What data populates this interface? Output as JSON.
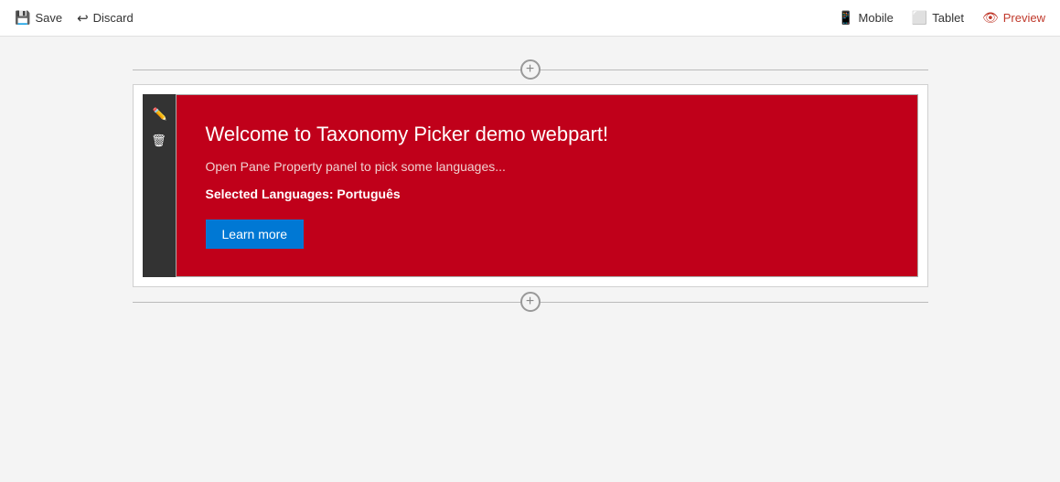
{
  "toolbar": {
    "save_label": "Save",
    "discard_label": "Discard",
    "mobile_label": "Mobile",
    "tablet_label": "Tablet",
    "preview_label": "Preview"
  },
  "webpart": {
    "title": "Welcome to Taxonomy Picker demo webpart!",
    "subtitle": "Open Pane Property panel to pick some languages...",
    "selected_text": "Selected Languages: Português",
    "learn_more_label": "Learn more"
  },
  "add_row": {
    "symbol": "+"
  }
}
